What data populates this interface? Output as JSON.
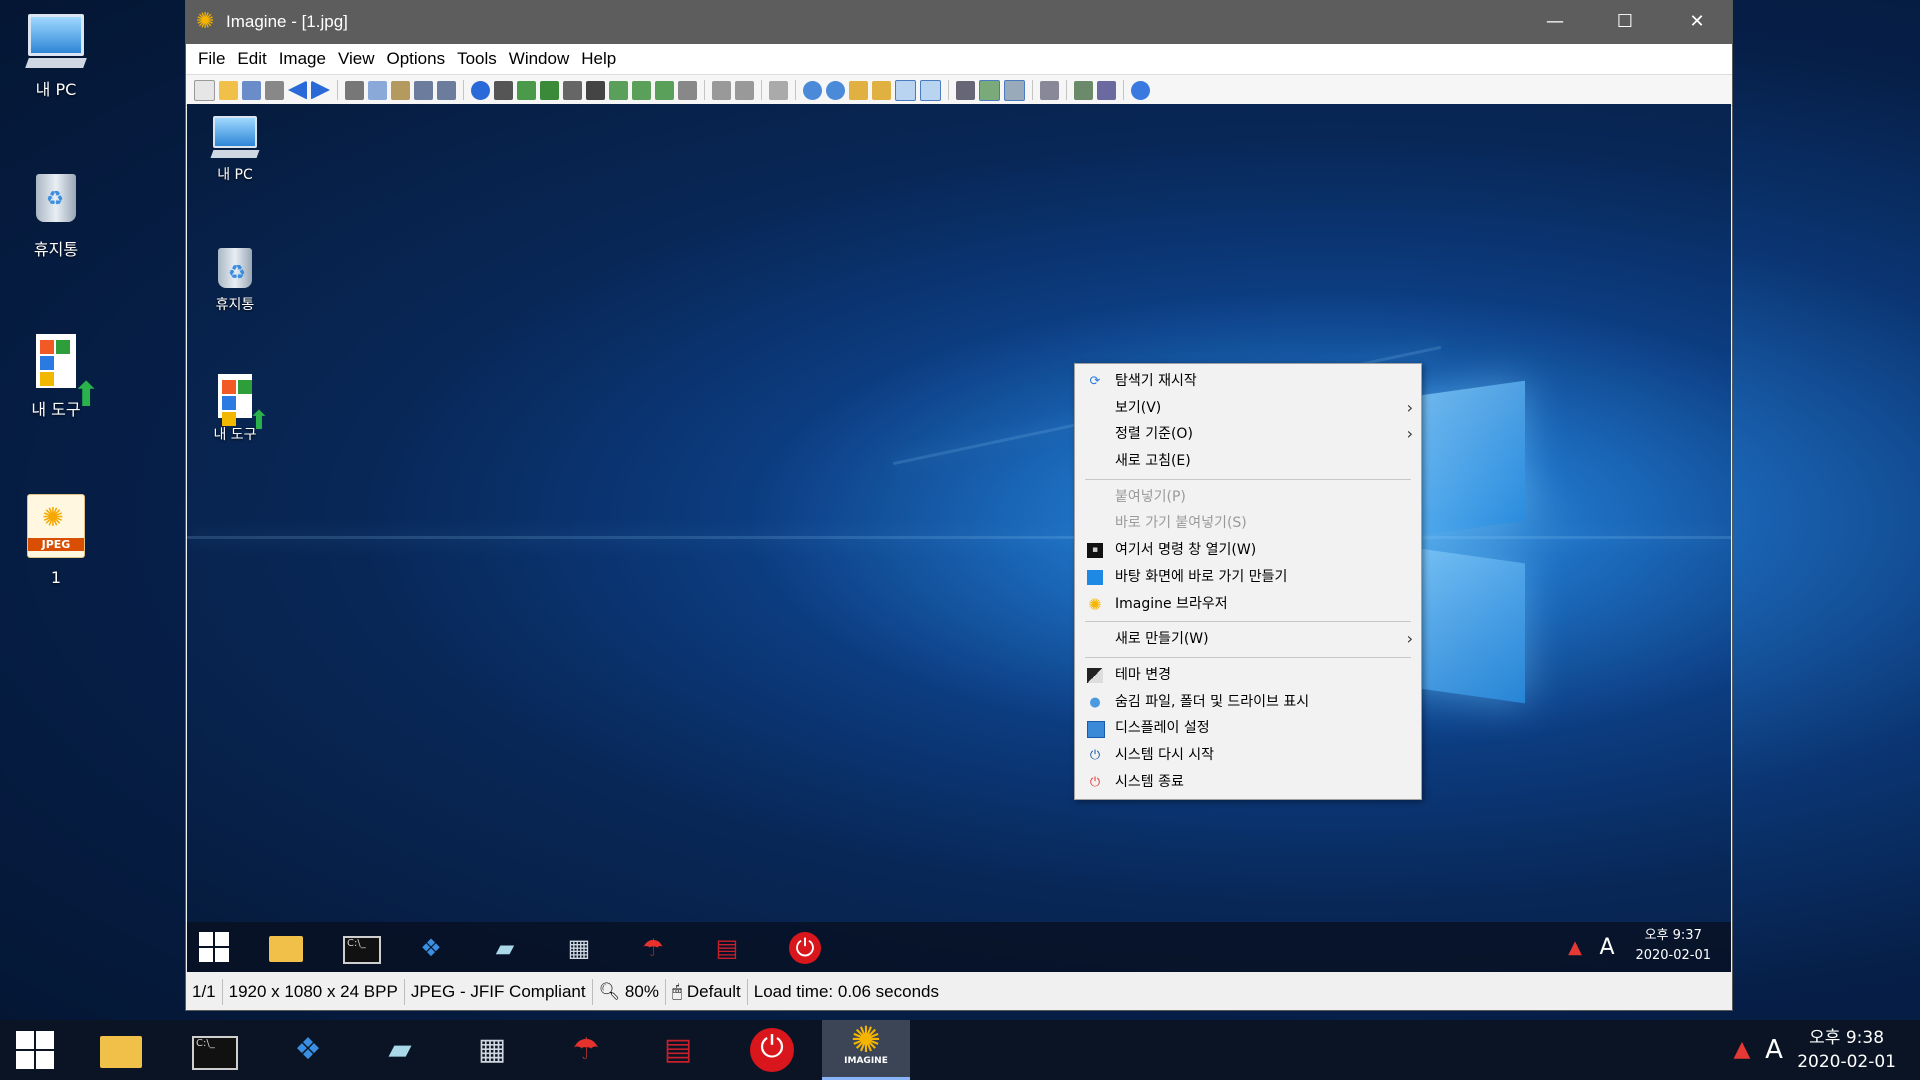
{
  "desktop": {
    "icons": [
      {
        "label": "내 PC"
      },
      {
        "label": "휴지통"
      },
      {
        "label": "내 도구"
      },
      {
        "label": "1",
        "badge": "JPEG"
      }
    ]
  },
  "window": {
    "title": "Imagine - [1.jpg]",
    "controls": {
      "minimize": "—",
      "maximize": "☐",
      "close": "✕"
    },
    "menu": [
      "File",
      "Edit",
      "Image",
      "View",
      "Options",
      "Tools",
      "Window",
      "Help"
    ],
    "status": {
      "page": "1/1",
      "dimensions": "1920 x 1080 x 24 BPP",
      "format": "JPEG - JFIF Compliant",
      "zoom": "80%",
      "mode": "Default",
      "load_time": "Load time: 0.06 seconds"
    }
  },
  "image": {
    "icons": [
      {
        "label": "내 PC"
      },
      {
        "label": "휴지통"
      },
      {
        "label": "내 도구"
      }
    ],
    "context_menu": {
      "items": [
        {
          "label": "탐색기 재시작",
          "icon": "refresh-icon",
          "color": "#2a7ae2"
        },
        {
          "label": "보기(V)",
          "submenu": true
        },
        {
          "label": "정렬 기준(O)",
          "submenu": true
        },
        {
          "label": "새로 고침(E)"
        },
        {
          "label": "붙여넣기(P)",
          "disabled": true
        },
        {
          "label": "바로 가기 붙여넣기(S)",
          "disabled": true
        },
        {
          "label": "여기서 명령 창 열기(W)",
          "icon": "cmd-icon"
        },
        {
          "label": "바탕 화면에 바로 가기 만들기",
          "icon": "desktop-icon"
        },
        {
          "label": "Imagine 브라우저",
          "icon": "imagine-icon"
        },
        {
          "label": "새로 만들기(W)",
          "submenu": true
        },
        {
          "label": "테마 변경",
          "icon": "theme-icon"
        },
        {
          "label": "숨김 파일, 폴더 및 드라이브 표시",
          "icon": "hidden-files-icon"
        },
        {
          "label": "디스플레이 설정",
          "icon": "display-icon"
        },
        {
          "label": "시스템 다시 시작",
          "icon": "restart-icon"
        },
        {
          "label": "시스템 종료",
          "icon": "shutdown-icon"
        }
      ]
    },
    "tray": {
      "ime": "A",
      "time": "오후 9:37",
      "date": "2020-02-01"
    }
  },
  "taskbar": {
    "ime": "A",
    "time": "오후 9:38",
    "date": "2020-02-01",
    "active_app_label": "IMAGINE"
  },
  "colors": {
    "accent": "#0078d7",
    "power": "#d8161c",
    "imagine_sun": "#f4b400"
  }
}
